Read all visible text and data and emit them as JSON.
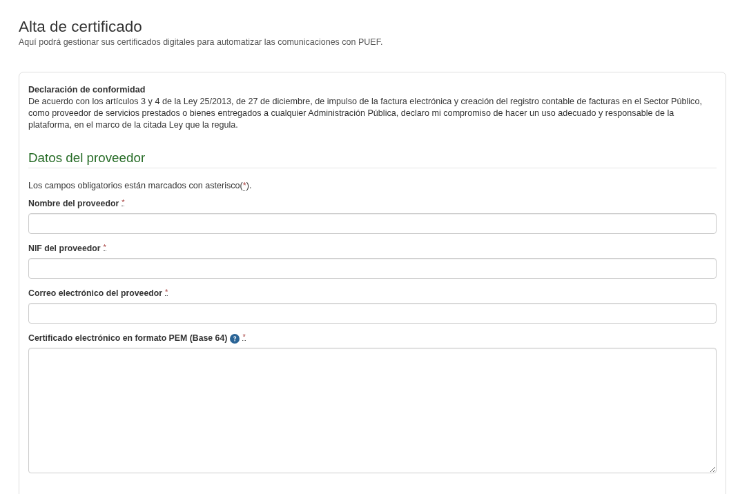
{
  "page": {
    "title": "Alta de certificado",
    "subtitle": "Aquí podrá gestionar sus certificados digitales para automatizar las comunicaciones con PUEF."
  },
  "declaration": {
    "title": "Declaración de conformidad",
    "text": "De acuerdo con los artículos 3 y 4 de la Ley 25/2013, de 27 de diciembre, de impulso de la factura electrónica y creación del registro contable de facturas en el Sector Público, como proveedor de servicios prestados o bienes entregados a cualquier Administración Pública, declaro mi compromiso de hacer un uso adecuado y responsable de la plataforma, en el marco de la citada Ley que la regula."
  },
  "section": {
    "title": "Datos del proveedor",
    "note": {
      "before": "Los campos obligatorios están marcados con asterisco(",
      "mark": "*",
      "after": ")."
    }
  },
  "fields": [
    {
      "kind": "input",
      "label": "Nombre del proveedor",
      "required_mark": "*"
    },
    {
      "kind": "input",
      "label": "NIF del proveedor",
      "required_mark": "*"
    },
    {
      "kind": "input",
      "label": "Correo electrónico del proveedor",
      "required_mark": "*"
    },
    {
      "kind": "textarea",
      "label": "Certificado electrónico en formato PEM (Base 64)",
      "help": true,
      "required_mark": "*"
    }
  ]
}
